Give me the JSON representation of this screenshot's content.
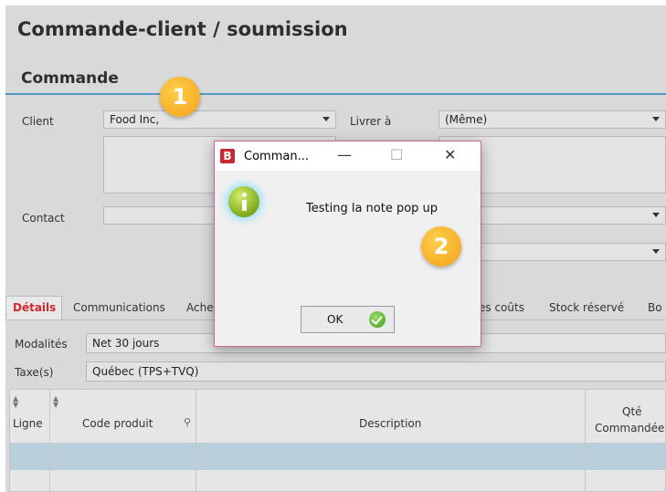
{
  "page": {
    "title": "Commande-client / soumission",
    "section": "Commande"
  },
  "form": {
    "client_label": "Client",
    "client_value": "Food Inc,",
    "livrer_label": "Livrer à",
    "livrer_value": "(Même)",
    "contact_label": "Contact"
  },
  "badges": {
    "one": "1",
    "two": "2"
  },
  "tabs": [
    {
      "label": "Détails"
    },
    {
      "label": "Communications"
    },
    {
      "label": "Ache"
    },
    {
      "label": "es coûts"
    },
    {
      "label": "Stock réservé"
    },
    {
      "label": "Bo"
    }
  ],
  "terms": {
    "modalites_label": "Modalités",
    "modalites_value": "Net 30 jours",
    "taxes_label": "Taxe(s)",
    "taxes_value": "Québec (TPS+TVQ)"
  },
  "grid": {
    "columns": [
      {
        "label": "Ligne"
      },
      {
        "label": "Code produit"
      },
      {
        "label": "Description"
      },
      {
        "label": "Qté",
        "sub": "Commandée"
      }
    ]
  },
  "dialog": {
    "title": "Comman...",
    "app_icon": "B",
    "minimize": "—",
    "maximize": "☐",
    "close": "✕",
    "message": "Testing la note pop up",
    "ok_label": "OK",
    "icons": {
      "info": "info-icon",
      "check": "check-icon"
    }
  },
  "colors": {
    "accent": "#4f97c8",
    "active_tab": "#d0282e",
    "dialog_border": "#c9659b",
    "badge": "#f4a01a"
  }
}
